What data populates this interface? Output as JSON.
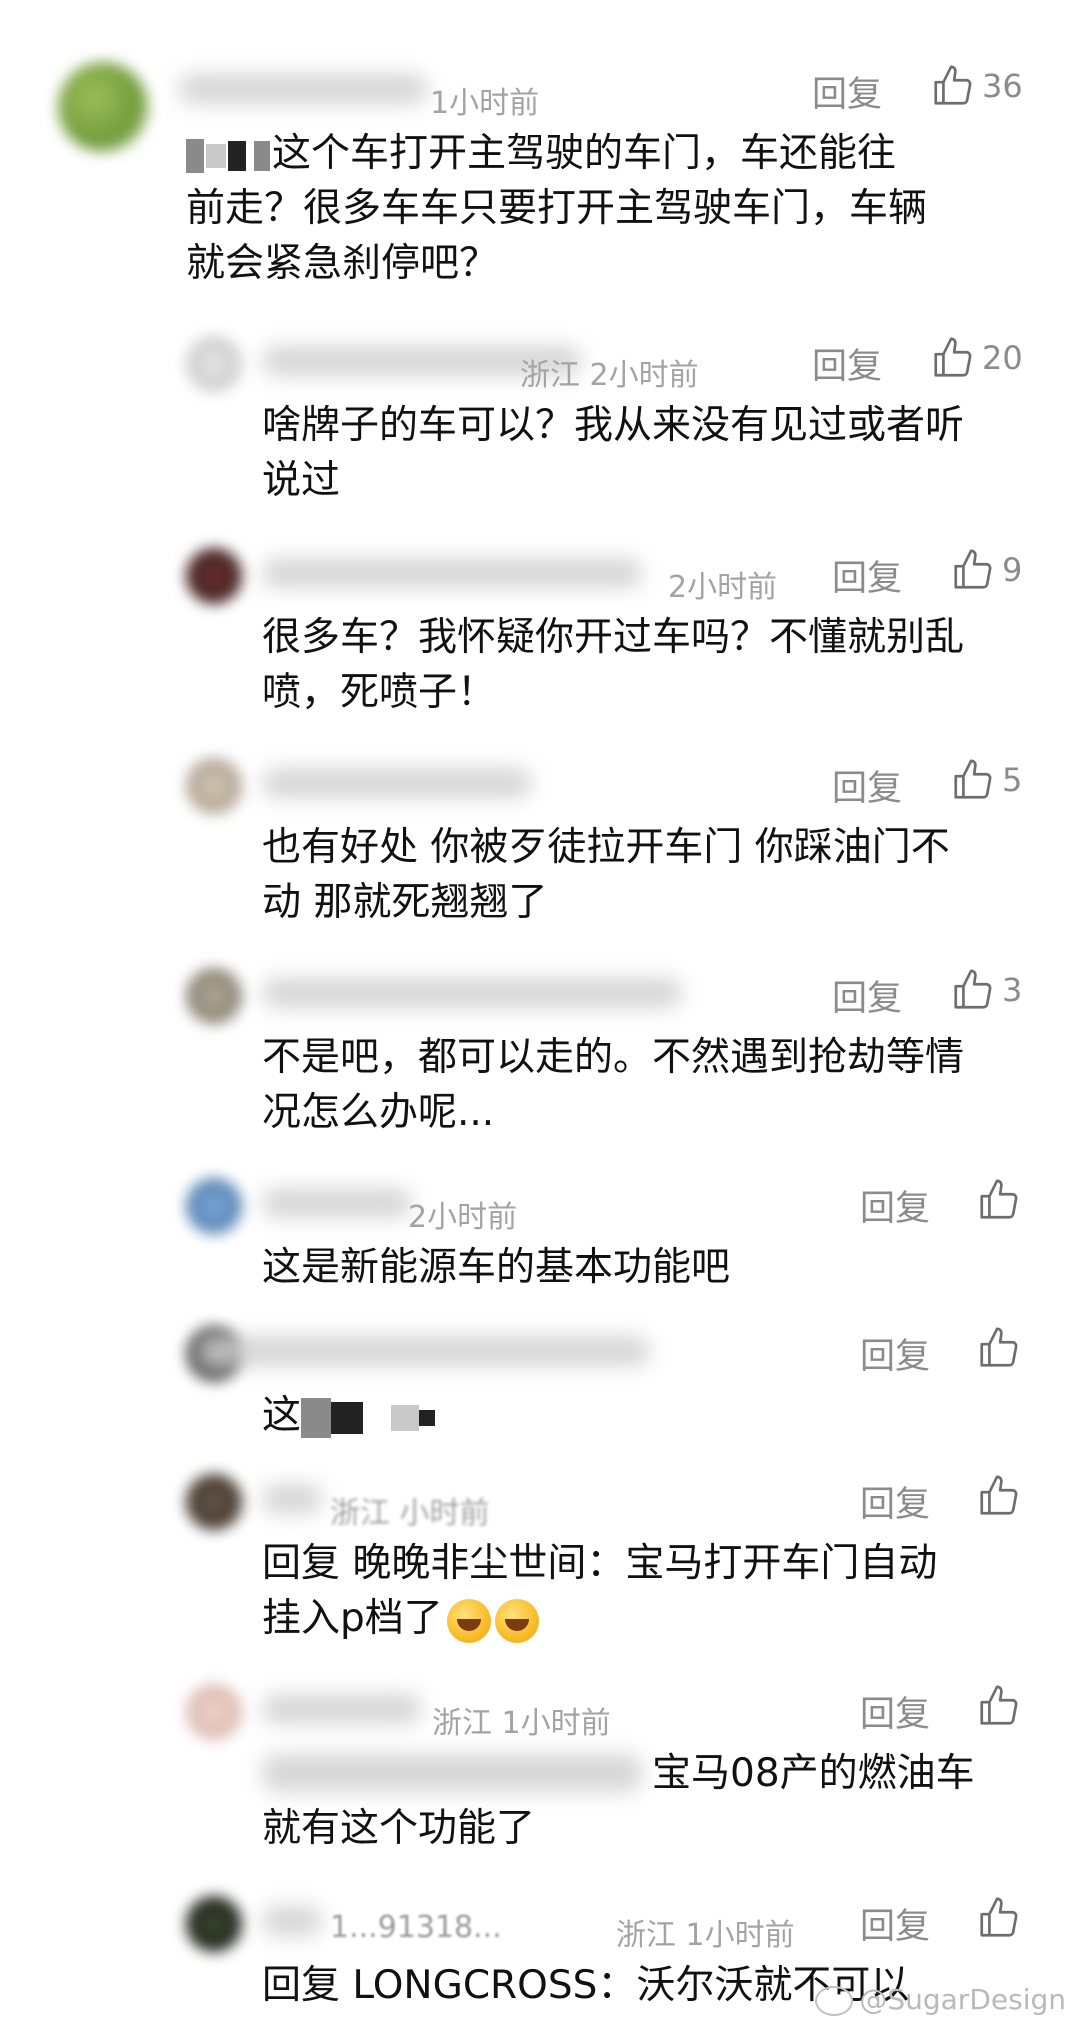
{
  "comments": [
    {
      "meta": "1小时前",
      "reply": "回复",
      "likes": "36",
      "text": "这个车打开主驾驶的车门，车还能往\n前走？很多车车只要打开主驾驶车门，车辆\n就会紧急刹停吧？"
    },
    {
      "meta": "浙江  2小时前",
      "reply": "回复",
      "likes": "20",
      "text": "啥牌子的车可以？我从来没有见过或者听\n说过"
    },
    {
      "meta": "2小时前",
      "reply": "回复",
      "likes": "9",
      "text": "很多车？我怀疑你开过车吗？不懂就别乱\n喷，死喷子！"
    },
    {
      "meta": "",
      "reply": "回复",
      "likes": "5",
      "text": "也有好处 你被歹徒拉开车门 你踩油门不\n动 那就死翘翘了"
    },
    {
      "meta": "",
      "reply": "回复",
      "likes": "3",
      "text": "不是吧，都可以走的。不然遇到抢劫等情\n况怎么办呢..."
    },
    {
      "meta": "2小时前",
      "reply": "回复",
      "likes": "",
      "text": "这是新能源车的基本功能吧"
    },
    {
      "meta": "",
      "reply": "回复",
      "likes": "",
      "text": "这"
    },
    {
      "meta": "浙江  小时前",
      "reply": "回复",
      "likes": "",
      "text": "回复 晚晚非尘世间：宝马打开车门自动\n挂入p档了"
    },
    {
      "meta": "浙江  1小时前",
      "reply": "回复",
      "likes": "",
      "text": "宝马08产的燃油车\n就有这个功能了"
    },
    {
      "meta": "浙江  1小时前",
      "name_partial": "1...91318...",
      "reply": "回复",
      "likes": "",
      "text": "回复 LONGCROSS：沃尔沃就不可以"
    }
  ],
  "watermark": "@SugarDesign",
  "colors": {
    "meta": "#a3a3a3",
    "action": "#8b8b8b",
    "text": "#111111"
  }
}
